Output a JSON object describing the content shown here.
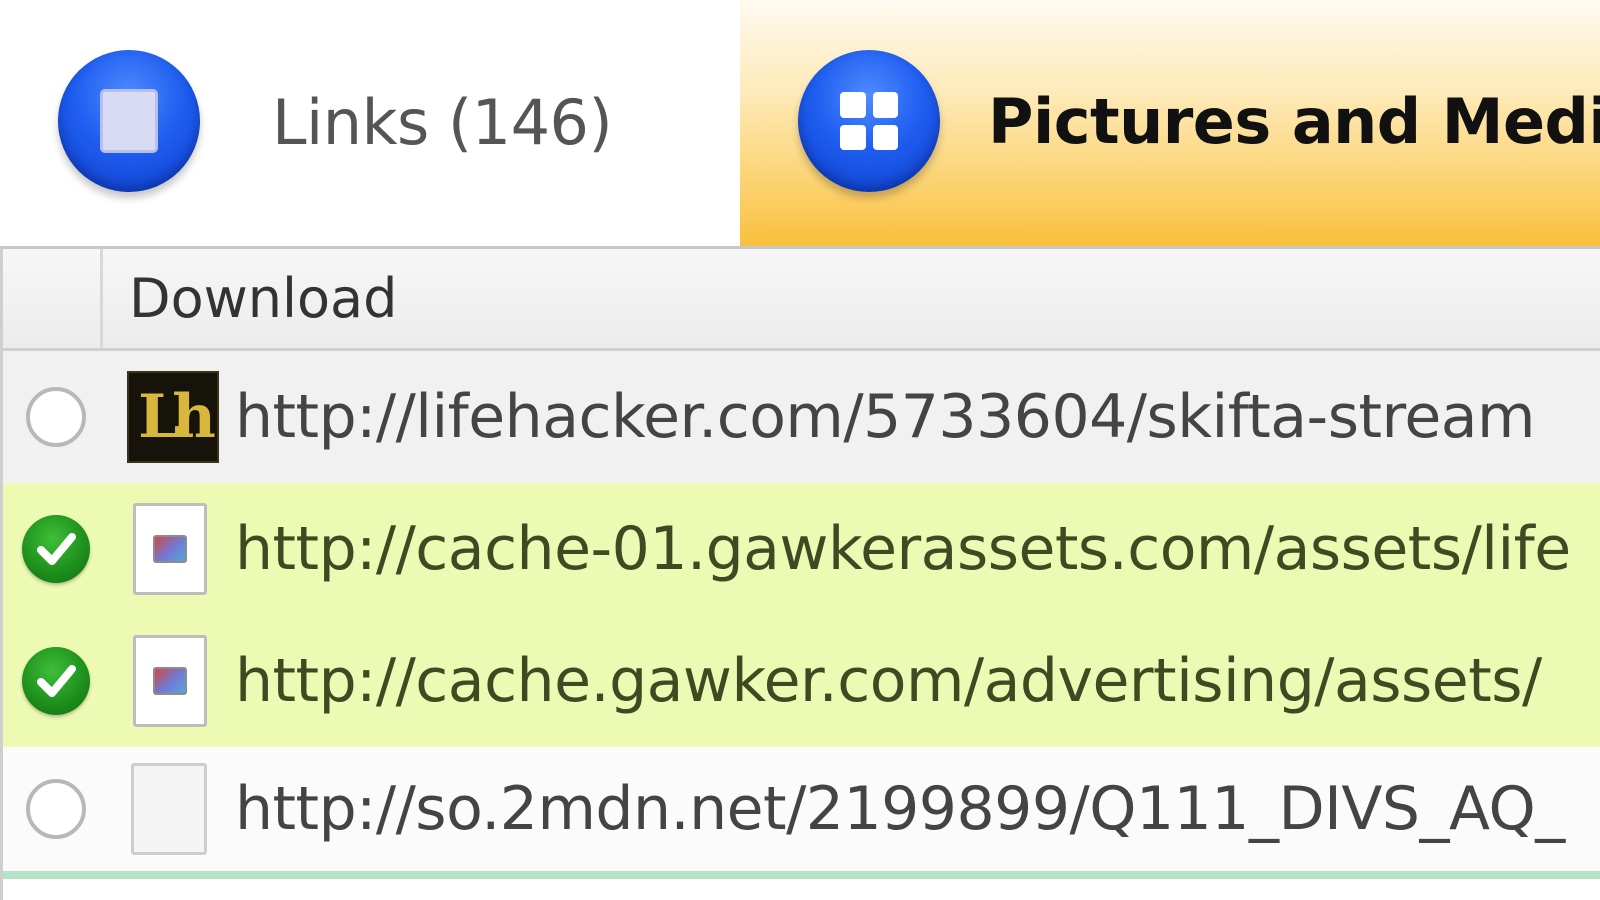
{
  "tabs": [
    {
      "label": "Links (146)",
      "icon": "list-square-icon",
      "active": false
    },
    {
      "label": "Pictures and Media",
      "icon": "grid-icon",
      "active": true
    }
  ],
  "colors": {
    "active_tab": "#fcd06a",
    "selected_row": "#ecfab4",
    "tab_icon_blue": "#1f5ef0",
    "check_green": "#1c8d1a"
  },
  "list": {
    "header_title": "Download",
    "rows": [
      {
        "url": "http://lifehacker.com/5733604/skifta-stream",
        "selected": false,
        "thumb": "lifehacker-logo"
      },
      {
        "url": "http://cache-01.gawkerassets.com/assets/life",
        "selected": true,
        "thumb": "image-file-icon"
      },
      {
        "url": "http://cache.gawker.com/advertising/assets/",
        "selected": true,
        "thumb": "image-file-icon"
      },
      {
        "url": "http://so.2mdn.net/2199899/Q111_DIVS_AQ_",
        "selected": false,
        "thumb": "blank-file-icon"
      }
    ]
  },
  "thumb_text": {
    "lifehacker": "Lh"
  }
}
